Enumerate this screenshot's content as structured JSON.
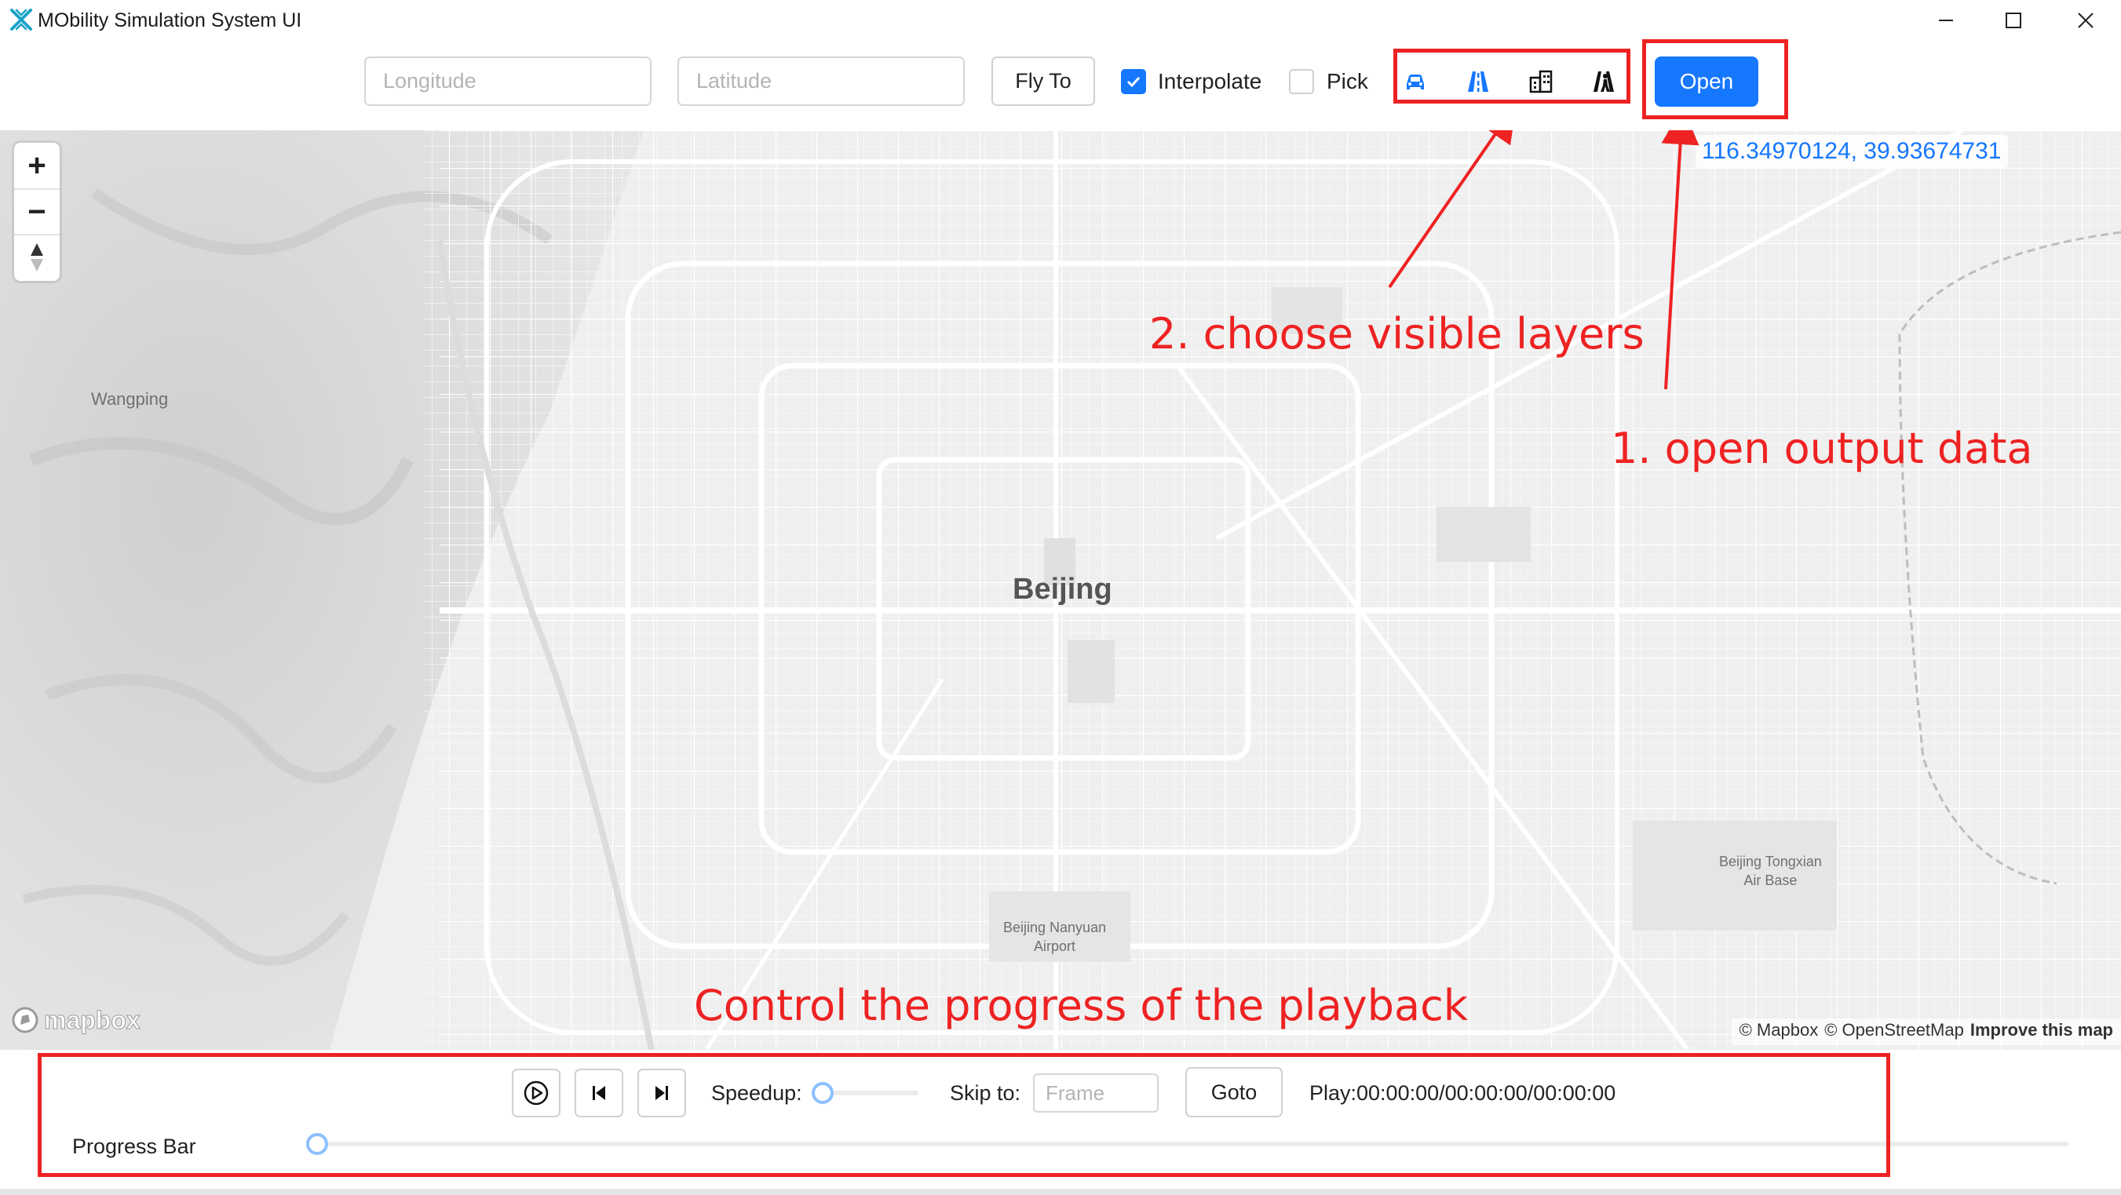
{
  "window": {
    "title": "MObility Simulation System UI",
    "controls": [
      "minimize-icon",
      "maximize-icon",
      "close-icon"
    ]
  },
  "toolbar": {
    "longitude_placeholder": "Longitude",
    "latitude_placeholder": "Latitude",
    "longitude_value": "",
    "latitude_value": "",
    "fly_to_label": "Fly To",
    "interpolate_label": "Interpolate",
    "interpolate_checked": true,
    "pick_label": "Pick",
    "pick_checked": false,
    "layer_icons": [
      "car-icon",
      "road-icon",
      "building-icon",
      "pedestrian-road-icon"
    ],
    "open_label": "Open"
  },
  "map": {
    "cursor_coordinates": "116.34970124, 39.93674731",
    "places": {
      "beijing": "Beijing",
      "wangping": "Wangping",
      "nanyuan_line1": "Beijing Nanyuan",
      "nanyuan_line2": "Airport",
      "tongxian_line1": "Beijing Tongxian",
      "tongxian_line2": "Air Base"
    },
    "zoom_in": "+",
    "zoom_out": "−",
    "logo": "mapbox",
    "attribution_mapbox": "© Mapbox",
    "attribution_osm": "© OpenStreetMap",
    "improve_map": "Improve this map"
  },
  "annotations": {
    "layers": "2. choose visible layers",
    "open": "1. open output data",
    "playback": "Control the progress of the playback",
    "color": "#ee2222"
  },
  "playback": {
    "speedup_label": "Speedup:",
    "speedup_value": 0,
    "skip_to_label": "Skip to:",
    "frame_placeholder": "Frame",
    "goto_label": "Goto",
    "play_status": "Play:00:00:00/00:00:00/00:00:00",
    "progress_label": "Progress Bar",
    "progress_value": 0
  },
  "colors": {
    "accent": "#1677ff",
    "map_background": "#efefef",
    "annotation_red": "#ee2222"
  }
}
